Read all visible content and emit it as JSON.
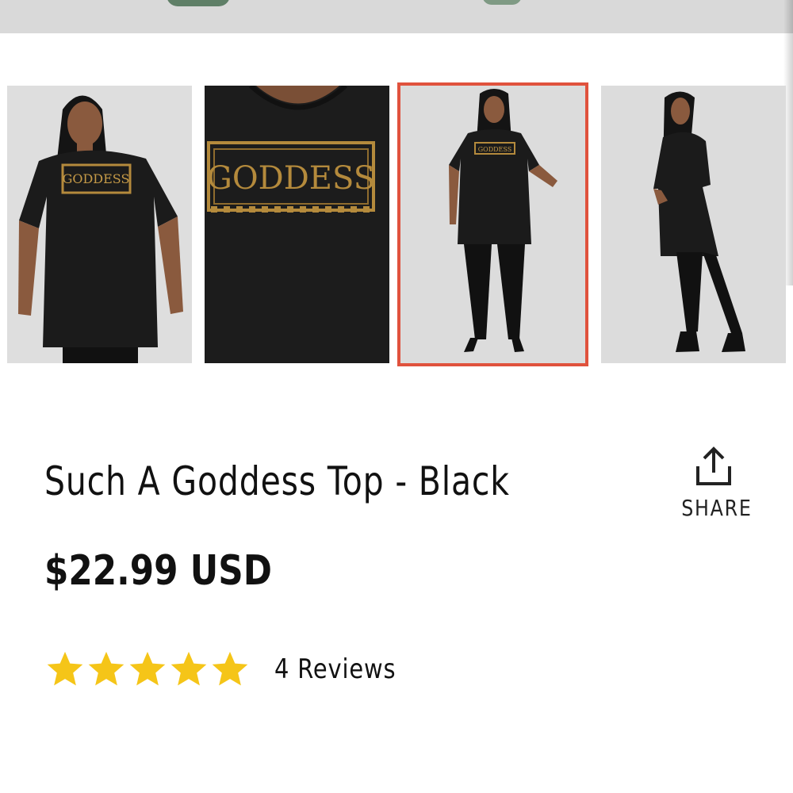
{
  "gallery": {
    "thumbnails": [
      {
        "view": "front-model",
        "print_text": "GODDESS",
        "selected": false
      },
      {
        "view": "print-closeup",
        "print_text": "GODDESS",
        "selected": false
      },
      {
        "view": "full-body-front",
        "print_text": "GODDESS",
        "selected": true
      },
      {
        "view": "full-body-side",
        "print_text": "",
        "selected": false
      }
    ]
  },
  "product": {
    "title": "Such A Goddess Top - Black",
    "price": "$22.99 USD"
  },
  "share": {
    "label": "SHARE",
    "icon": "share-upload-icon"
  },
  "rating": {
    "stars": 5,
    "max": 5,
    "reviews_label": "4 Reviews",
    "star_color": "#f5c518"
  },
  "colors": {
    "selected_border": "#e0523d",
    "garment": "#1a1a1a",
    "print_gold": "#b48a3c"
  }
}
